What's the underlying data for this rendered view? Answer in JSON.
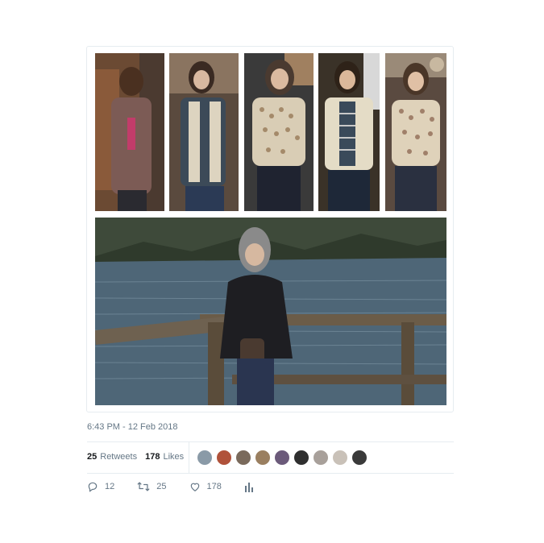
{
  "tweet": {
    "timestamp": "6:43 PM - 12 Feb 2018",
    "retweets_count": "25",
    "retweets_label": "Retweets",
    "likes_count": "178",
    "likes_label": "Likes"
  },
  "liker_avatars": [
    "#8a9aa7",
    "#b0523a",
    "#7a6a5c",
    "#9a7f60",
    "#6b5a7a",
    "#2f2f2f",
    "#a8a09a",
    "#c9c1b8",
    "#3a3a3a"
  ],
  "actions": {
    "reply_count": "12",
    "retweet_count": "25",
    "like_count": "178"
  },
  "icons": {
    "reply": "reply-icon",
    "retweet": "retweet-icon",
    "like": "heart-icon",
    "analytics": "analytics-icon"
  }
}
